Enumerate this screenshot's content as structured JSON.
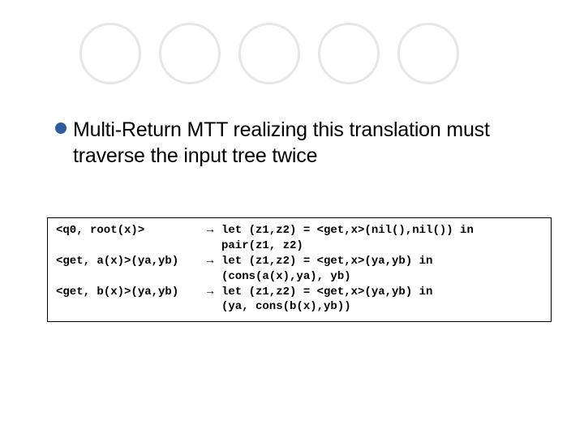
{
  "bullet": {
    "text": "Multi-Return MTT realizing this translation must traverse the input tree twice"
  },
  "code": {
    "rows": [
      {
        "lhs": "<q0, root(x)>",
        "arrow": "→",
        "rhs": "let (z1,z2) = <get,x>(nil(),nil()) in",
        "cont": false
      },
      {
        "lhs": "",
        "arrow": "",
        "rhs": "pair(z1, z2)",
        "cont": true
      },
      {
        "lhs": "<get, a(x)>(ya,yb)",
        "arrow": "→",
        "rhs": "let (z1,z2) = <get,x>(ya,yb) in",
        "cont": false
      },
      {
        "lhs": "",
        "arrow": "",
        "rhs": "(cons(a(x),ya), yb)",
        "cont": true
      },
      {
        "lhs": "<get, b(x)>(ya,yb)",
        "arrow": "→",
        "rhs": "let (z1,z2) = <get,x>(ya,yb) in",
        "cont": false
      },
      {
        "lhs": "",
        "arrow": "",
        "rhs": "(ya, cons(b(x),yb))",
        "cont": true
      }
    ]
  }
}
